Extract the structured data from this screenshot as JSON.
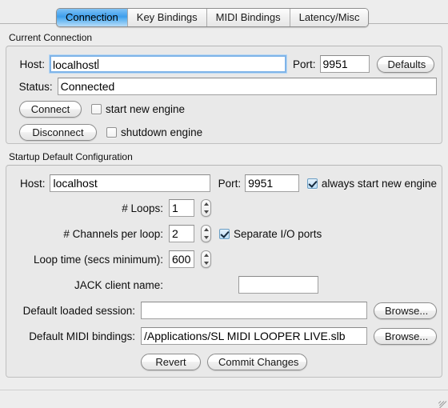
{
  "tabs": [
    {
      "label": "Connection",
      "active": true
    },
    {
      "label": "Key Bindings",
      "active": false
    },
    {
      "label": "MIDI Bindings",
      "active": false
    },
    {
      "label": "Latency/Misc",
      "active": false
    }
  ],
  "current_connection": {
    "group_label": "Current Connection",
    "host_label": "Host:",
    "host_value": "localhost",
    "port_label": "Port:",
    "port_value": "9951",
    "defaults_button": "Defaults",
    "status_label": "Status:",
    "status_value": "Connected",
    "connect_button": "Connect",
    "start_new_engine_label": "start new engine",
    "start_new_engine_checked": false,
    "disconnect_button": "Disconnect",
    "shutdown_engine_label": "shutdown engine",
    "shutdown_engine_checked": false
  },
  "startup_defaults": {
    "group_label": "Startup Default Configuration",
    "host_label": "Host:",
    "host_value": "localhost",
    "port_label": "Port:",
    "port_value": "9951",
    "always_start_label": "always start new engine",
    "always_start_checked": true,
    "loops_label": "# Loops:",
    "loops_value": "1",
    "channels_label": "# Channels per loop:",
    "channels_value": "2",
    "separate_io_label": "Separate I/O ports",
    "separate_io_checked": true,
    "looptime_label": "Loop time (secs minimum):",
    "looptime_value": "600",
    "jack_label": "JACK client name:",
    "jack_value": "",
    "session_label": "Default loaded session:",
    "session_value": "",
    "session_browse": "Browse...",
    "midi_label": "Default MIDI bindings:",
    "midi_value": "/Applications/SL MIDI LOOPER LIVE.slb",
    "midi_browse": "Browse...",
    "revert_button": "Revert",
    "commit_button": "Commit Changes"
  },
  "colors": {
    "window_bg": "#ededed",
    "group_bg": "#e9e9e9",
    "accent_blue": "#3d9eec",
    "focus_ring": "#7fb4e8"
  }
}
